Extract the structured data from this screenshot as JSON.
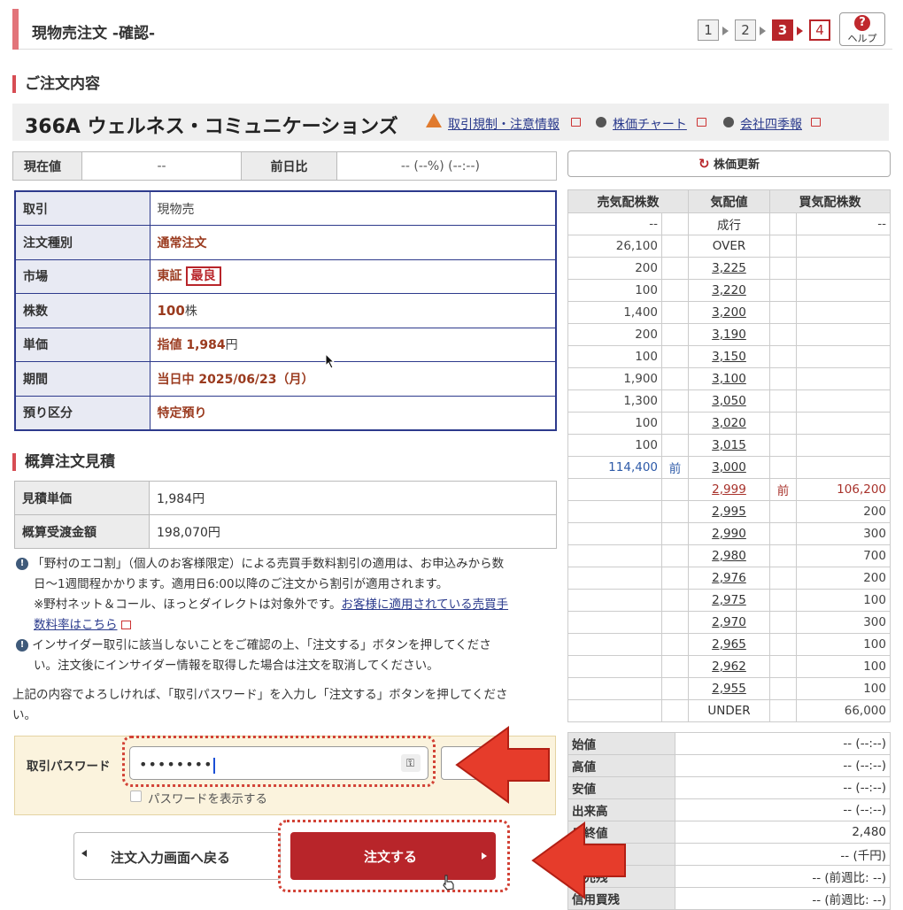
{
  "header": {
    "title": "現物売注文 -確認-",
    "steps": [
      "1",
      "2",
      "3",
      "4"
    ],
    "help_label": "ヘルプ"
  },
  "order_section_title": "ご注文内容",
  "stock": {
    "name": "366A ウェルネス・コミュニケーションズ",
    "links": [
      "取引規制・注意情報",
      "株価チャート",
      "会社四季報"
    ]
  },
  "price_bar": {
    "current_label": "現在値",
    "current_value": "--",
    "change_label": "前日比",
    "change_value": "-- (--%) (--:--)"
  },
  "order": [
    {
      "label": "取引",
      "value": "現物売"
    },
    {
      "label": "注文種別",
      "value": "通常注文"
    },
    {
      "label": "市場",
      "value": "東証",
      "badge": "最良"
    },
    {
      "label": "株数",
      "value": "100",
      "unit": "株"
    },
    {
      "label": "単価",
      "value": "指値 1,984",
      "unit": "円"
    },
    {
      "label": "期間",
      "value": "当日中 2025/06/23（月）"
    },
    {
      "label": "預り区分",
      "value": "特定預り"
    }
  ],
  "estimate": {
    "title": "概算注文見積",
    "rows": [
      {
        "label": "見積単価",
        "value": "1,984円"
      },
      {
        "label": "概算受渡金額",
        "value": "198,070円"
      }
    ]
  },
  "notes": {
    "n1_line1": "「野村のエコ割」（個人のお客様限定）による売買手数料割引の適用は、お申込みから数",
    "n1_line2": "日〜1週間程かかります。適用日6:00以降のご注文から割引が適用されます。",
    "n1_line3": "※野村ネット＆コール、ほっとダイレクトは対象外です。",
    "n1_link1": "お客様に適用されている売買手",
    "n1_link2": "数料率はこちら",
    "n2_line1": "インサイダー取引に該当しないことをご確認の上、「注文する」ボタンを押してくださ",
    "n2_line2": "い。注文後にインサイダー情報を取得した場合は注文を取消してください。",
    "confirm_line1": "上記の内容でよろしければ、「取引パスワード」を入力し「注文する」ボタンを押してくださ",
    "confirm_line2": "い。"
  },
  "password": {
    "label": "取引パスワード",
    "value": "••••••••",
    "show_label": "パスワードを表示する"
  },
  "buttons": {
    "back": "注文入力画面へ戻る",
    "order": "注文する"
  },
  "refresh_label": "株価更新",
  "board": {
    "headers": [
      "売気配株数",
      "気配値",
      "買気配株数"
    ],
    "rows": [
      {
        "sell": "--",
        "price": "成行",
        "buy": "--"
      },
      {
        "sell": "26,100",
        "price": "OVER",
        "buy": ""
      },
      {
        "sell": "200",
        "price": "3,225",
        "buy": ""
      },
      {
        "sell": "100",
        "price": "3,220",
        "buy": ""
      },
      {
        "sell": "1,400",
        "price": "3,200",
        "buy": ""
      },
      {
        "sell": "200",
        "price": "3,190",
        "buy": ""
      },
      {
        "sell": "100",
        "price": "3,150",
        "buy": ""
      },
      {
        "sell": "1,900",
        "price": "3,100",
        "buy": ""
      },
      {
        "sell": "1,300",
        "price": "3,050",
        "buy": ""
      },
      {
        "sell": "100",
        "price": "3,020",
        "buy": ""
      },
      {
        "sell": "100",
        "price": "3,015",
        "buy": ""
      },
      {
        "sell": "114,400",
        "sell_mark": "前",
        "price": "3,000",
        "buy": ""
      },
      {
        "sell": "",
        "price": "2,999",
        "buy_mark": "前",
        "buy": "106,200"
      },
      {
        "sell": "",
        "price": "2,995",
        "buy": "200"
      },
      {
        "sell": "",
        "price": "2,990",
        "buy": "300"
      },
      {
        "sell": "",
        "price": "2,980",
        "buy": "700"
      },
      {
        "sell": "",
        "price": "2,976",
        "buy": "200"
      },
      {
        "sell": "",
        "price": "2,975",
        "buy": "100"
      },
      {
        "sell": "",
        "price": "2,970",
        "buy": "300"
      },
      {
        "sell": "",
        "price": "2,965",
        "buy": "100"
      },
      {
        "sell": "",
        "price": "2,962",
        "buy": "100"
      },
      {
        "sell": "",
        "price": "2,955",
        "buy": "100"
      },
      {
        "sell": "",
        "price": "UNDER",
        "buy": "66,000"
      }
    ]
  },
  "summary": [
    {
      "label": "始値",
      "value": "-- (--:--)"
    },
    {
      "label": "高値",
      "value": "-- (--:--)"
    },
    {
      "label": "安値",
      "value": "-- (--:--)"
    },
    {
      "label": "出来高",
      "value": "-- (--:--)"
    },
    {
      "label": "日終値",
      "value": "2,480"
    },
    {
      "label": "",
      "value": "-- (千円)"
    },
    {
      "label": "用売残",
      "value": "-- (前週比: --)"
    },
    {
      "label": "信用買残",
      "value": "-- (前週比: --)"
    }
  ],
  "colors": {
    "accent_red": "#b8252a",
    "navy_border": "#2d3a8c",
    "arrow_red": "#e63c2b"
  }
}
